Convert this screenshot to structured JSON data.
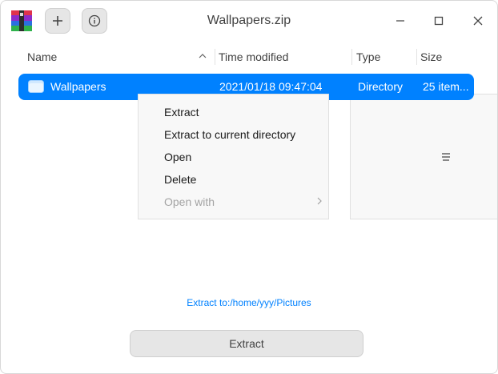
{
  "window": {
    "title": "Wallpapers.zip"
  },
  "toolbar": {
    "add_icon": "plus-icon",
    "info_icon": "info-icon"
  },
  "columns": {
    "name": "Name",
    "time": "Time modified",
    "type": "Type",
    "size": "Size"
  },
  "row": {
    "name": "Wallpapers",
    "time": "2021/01/18 09:47:04",
    "type": "Directory",
    "size": "25 item..."
  },
  "context_menu": {
    "items": [
      {
        "label": "Extract",
        "enabled": true
      },
      {
        "label": "Extract to current directory",
        "enabled": true
      },
      {
        "label": "Open",
        "enabled": true
      },
      {
        "label": "Delete",
        "enabled": true
      },
      {
        "label": "Open with",
        "enabled": false
      }
    ]
  },
  "extract_to": "Extract to:/home/yyy/Pictures",
  "extract_button": "Extract",
  "colors": {
    "accent": "#0081ff",
    "selection": "#0081ff",
    "disabled_text": "#a3a3a3"
  }
}
